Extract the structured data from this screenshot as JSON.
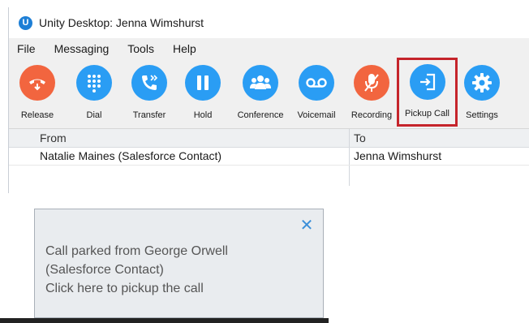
{
  "window": {
    "title": "Unity Desktop: Jenna Wimshurst",
    "app_icon_letter": "U"
  },
  "menu": [
    "File",
    "Messaging",
    "Tools",
    "Help"
  ],
  "toolbar": {
    "buttons": [
      {
        "label": "Release",
        "icon": "phone-hangup-icon",
        "color": "#f2653f"
      },
      {
        "label": "Dial",
        "icon": "dialpad-icon",
        "color": "#2a9df4"
      },
      {
        "label": "Transfer",
        "icon": "phone-transfer-icon",
        "color": "#2a9df4"
      },
      {
        "label": "Hold",
        "icon": "pause-icon",
        "color": "#2a9df4"
      },
      {
        "label": "Conference",
        "icon": "group-icon",
        "color": "#2a9df4"
      },
      {
        "label": "Voicemail",
        "icon": "voicemail-icon",
        "color": "#2a9df4"
      },
      {
        "label": "Recording",
        "icon": "mic-off-icon",
        "color": "#f2653f"
      },
      {
        "label": "Pickup Call",
        "icon": "pickup-icon",
        "color": "#2a9df4",
        "highlighted": true
      },
      {
        "label": "Settings",
        "icon": "gear-icon",
        "color": "#2a9df4"
      }
    ]
  },
  "calls_table": {
    "columns": [
      "From",
      "To"
    ],
    "rows": [
      {
        "from": "Natalie Maines (Salesforce Contact)",
        "to": "Jenna Wimshurst"
      }
    ]
  },
  "notification": {
    "close_icon": "close-icon",
    "lines": [
      "Call parked from George Orwell",
      "(Salesforce Contact)",
      "Click here to pickup the call"
    ]
  }
}
